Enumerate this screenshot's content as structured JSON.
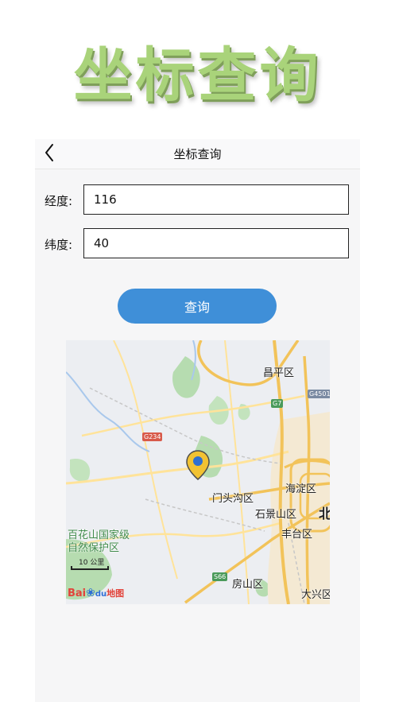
{
  "banner": {
    "title": "坐标查询"
  },
  "navbar": {
    "title": "坐标查询",
    "back_icon": "chevron-left-icon"
  },
  "form": {
    "longitude_label": "经度:",
    "longitude_value": "116",
    "latitude_label": "纬度:",
    "latitude_value": "40",
    "query_button": "查询"
  },
  "map": {
    "marker_icon": "map-pin-icon",
    "places": {
      "changping": "昌平区",
      "haidian": "海淀区",
      "mentougou": "门头沟区",
      "shijingshan": "石景山区",
      "beijing": "北",
      "fengtai": "丰台区",
      "baihuashan_line1": "百花山国家级",
      "baihuashan_line2": "自然保护区",
      "fangshan": "房山区",
      "daxing": "大兴区"
    },
    "road_shields": {
      "g4501": "G4501",
      "g7": "G7",
      "g234": "G234",
      "s66": "S66"
    },
    "scale_label": "10 公里",
    "logo": {
      "bai": "Bai",
      "du": "du",
      "ditu": "地图"
    },
    "colors": {
      "land": "#eceef2",
      "green": "#b6dcb0",
      "road_major": "#f2c35a",
      "road_minor": "#ffe39a",
      "marker_fill": "#f2c232",
      "marker_dot": "#2f6fd0"
    }
  }
}
